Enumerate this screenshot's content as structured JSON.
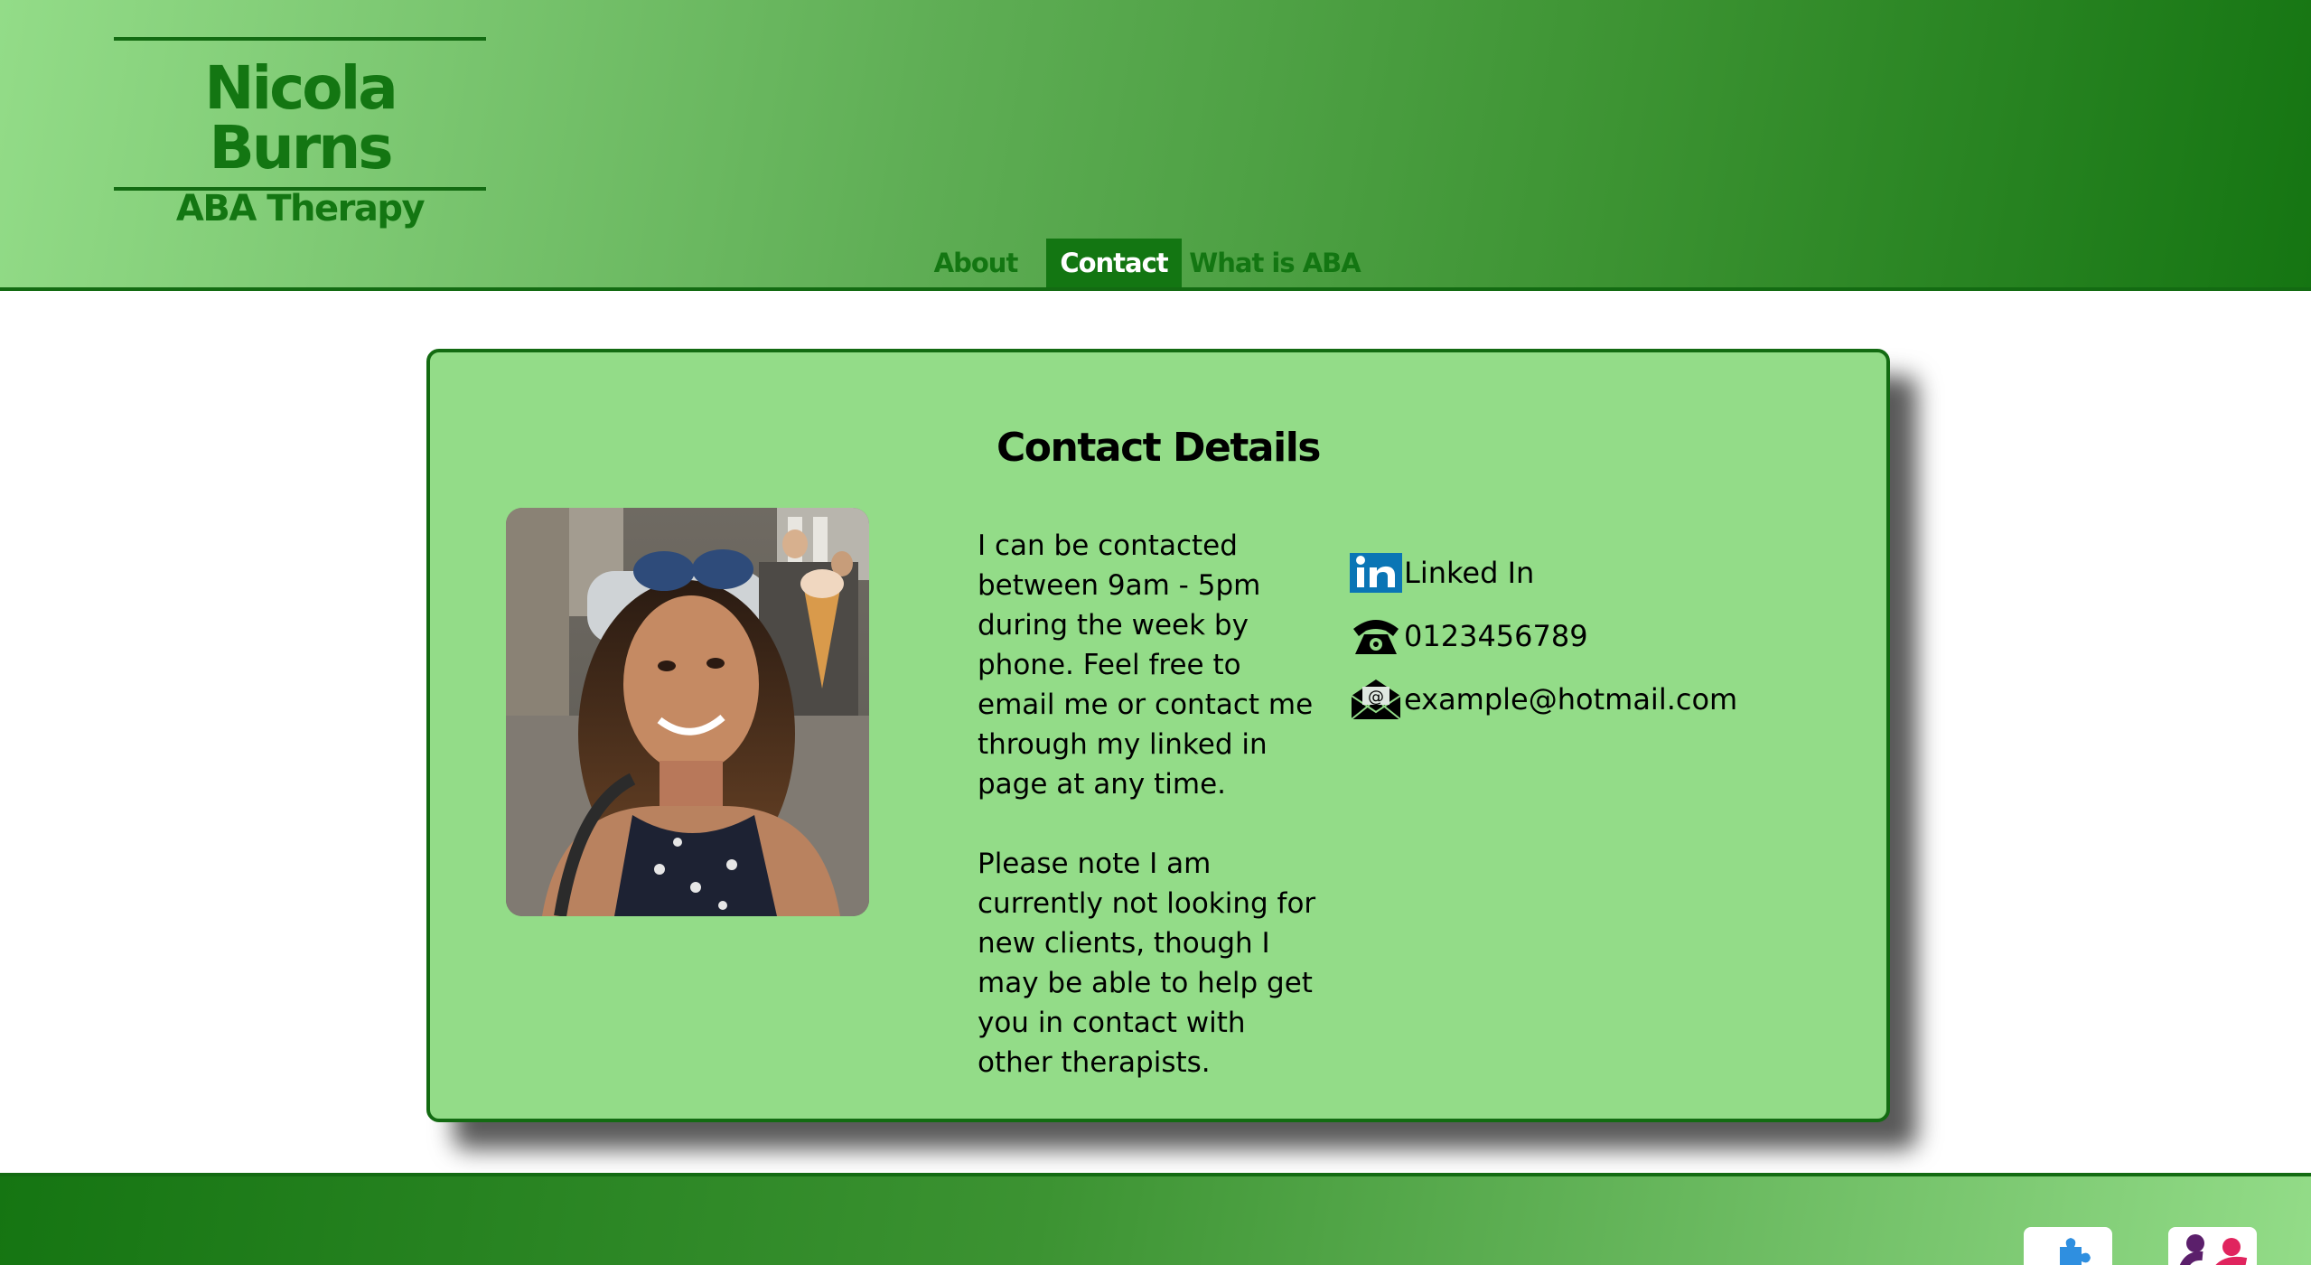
{
  "brand": {
    "name": "Nicola Burns",
    "subtitle": "ABA Therapy"
  },
  "nav": {
    "items": [
      {
        "label": "About",
        "active": false
      },
      {
        "label": "Contact",
        "active": true
      },
      {
        "label": "What is ABA",
        "active": false
      }
    ]
  },
  "contact": {
    "title": "Contact Details",
    "paragraph1": "I can be contacted between 9am - 5pm during the week by phone. Feel free to email me or contact me through my linked in page at any time.",
    "paragraph2": "Please note I am currently not looking for new clients, though I may be able to help get you in contact with other therapists.",
    "links": {
      "linkedin": "Linked In",
      "phone": "0123456789",
      "email": "example@hotmail.com"
    }
  },
  "colors": {
    "dark_green": "#136b12",
    "light_green": "#93dc88",
    "linkedin_blue": "#0a75b5"
  },
  "icons": [
    "linkedin-icon",
    "phone-icon",
    "email-icon",
    "puzzle-icon",
    "people-logo-icon"
  ]
}
